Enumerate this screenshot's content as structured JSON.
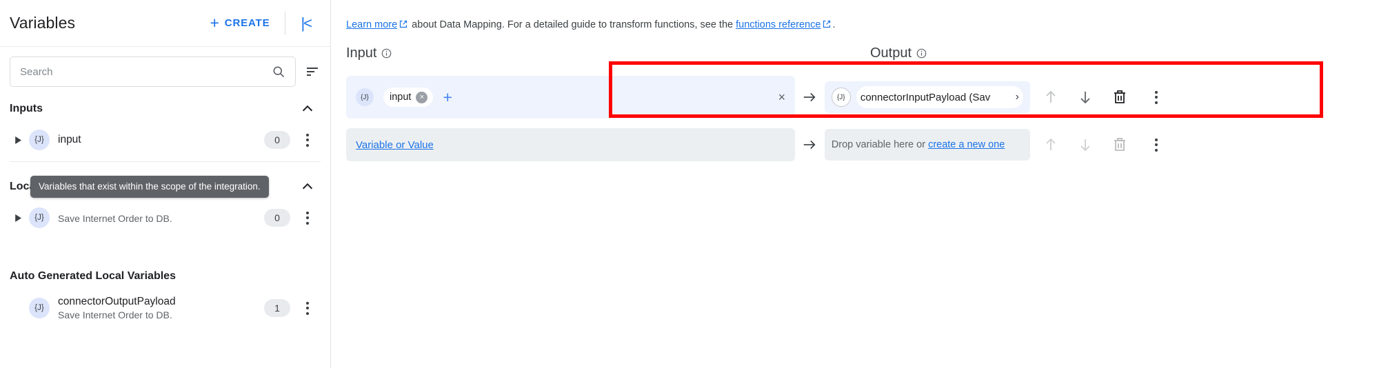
{
  "sidebar": {
    "title": "Variables",
    "create_label": "CREATE",
    "plus_icon": "+",
    "collapse_icon": "|<",
    "search": {
      "placeholder": "Search",
      "value": ""
    },
    "sections": [
      {
        "title": "Inputs",
        "items": [
          {
            "name": "input",
            "subtitle": "",
            "badge": "0",
            "icon": "{J}",
            "has_toggle": true
          }
        ]
      },
      {
        "title": "Local Variables",
        "items": [
          {
            "name": "",
            "subtitle": "Save Internet Order to DB.",
            "badge": "0",
            "icon": "{J}",
            "has_toggle": true
          }
        ]
      },
      {
        "title": "Auto Generated Local Variables",
        "items": [
          {
            "name": "connectorOutputPayload",
            "subtitle": "Save Internet Order to DB.",
            "badge": "1",
            "icon": "{J}",
            "has_toggle": false
          }
        ]
      }
    ],
    "tooltip": "Variables that exist within the scope of the integration."
  },
  "main": {
    "help_text": {
      "link1": "Learn more",
      "middle": " about Data Mapping. For a detailed guide to transform functions, see the ",
      "link2": "functions reference",
      "end": "."
    },
    "columns": {
      "input_label": "Input",
      "output_label": "Output"
    },
    "rows": [
      {
        "input": {
          "chip_label": "input",
          "chip_icon": "{J}",
          "chip_close": "×",
          "add_icon": "+",
          "clear_icon": "×"
        },
        "arrow": "→",
        "output": {
          "icon": "{J}",
          "label": "connectorInputPayload (Sav",
          "chevron": "›"
        },
        "actions": {
          "move_up": "↑",
          "move_down": "↓",
          "delete": "delete-icon",
          "more": "more-icon"
        }
      },
      {
        "input": {
          "placeholder_link": "Variable or Value"
        },
        "arrow": "→",
        "output": {
          "drop_text": "Drop variable here or ",
          "create_link": "create a new one"
        },
        "actions": {
          "move_up": "↑",
          "move_down": "↓",
          "delete": "delete-icon",
          "more": "more-icon"
        }
      }
    ]
  },
  "colors": {
    "accent": "#1a73e8",
    "highlight": "#ff0000",
    "chip_bg": "#eef3fd",
    "empty_bg": "#eceff1",
    "icon_bg": "#dbe4fb"
  }
}
